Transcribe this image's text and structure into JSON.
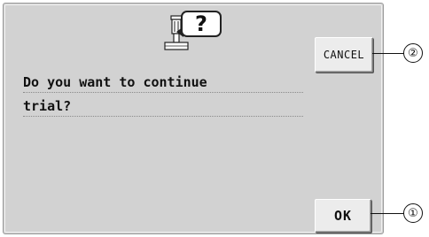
{
  "dialog": {
    "message_line_1": "Do you want to continue",
    "message_line_2": "trial?",
    "icon": "embroidery-machine-question-icon",
    "bubble_text": "?"
  },
  "buttons": {
    "cancel_label": "CANCEL",
    "ok_label": "OK"
  },
  "callouts": {
    "cancel_number": "②",
    "ok_number": "①"
  },
  "colors": {
    "panel_bg": "#d2d2d2",
    "button_bg": "#ececec",
    "text": "#111111"
  }
}
